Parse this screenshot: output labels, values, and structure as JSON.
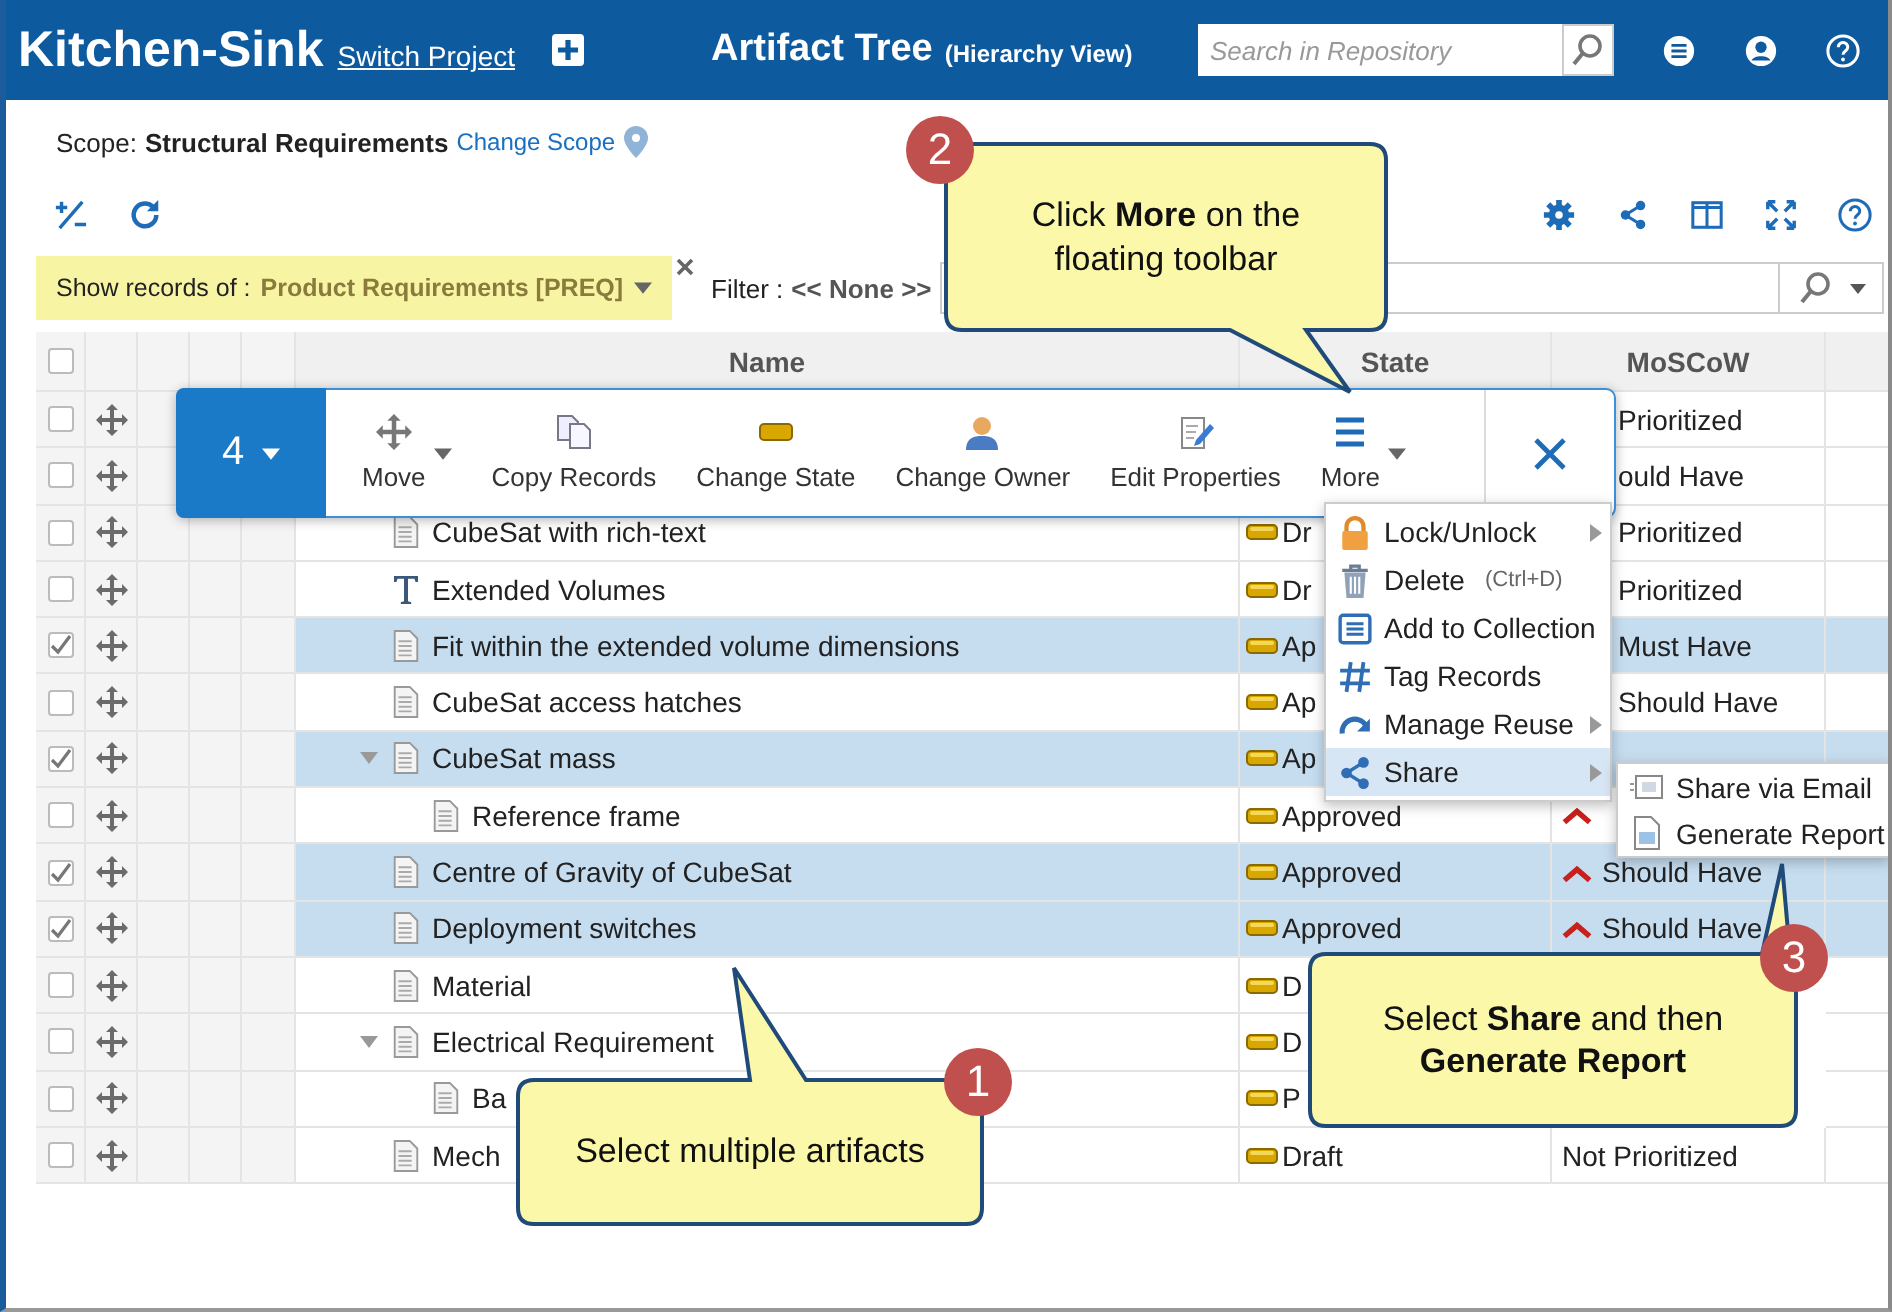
{
  "header": {
    "project": "Kitchen-Sink",
    "switch_link": "Switch Project",
    "title": "Artifact Tree",
    "subtitle": "(Hierarchy View)",
    "search": {
      "placeholder": "Search in Repository"
    }
  },
  "scope": {
    "label": "Scope:",
    "value": "Structural Requirements",
    "change_link": "Change Scope"
  },
  "filter_bar": {
    "show_label": "Show records of :",
    "show_value": "Product Requirements [PREQ]",
    "filter_label": "Filter :",
    "filter_value": "<< None >>"
  },
  "table": {
    "select_all_checked": false,
    "columns": [
      "Name",
      "State",
      "MoSCoW"
    ],
    "rows": [
      {
        "checked": false,
        "moscow": "Prioritized",
        "moscow_icon": false
      },
      {
        "checked": false,
        "moscow": "ould Have",
        "moscow_icon": false
      },
      {
        "checked": false,
        "kind": "document",
        "name": "CubeSat with rich-text",
        "state": "Dr",
        "moscow": "Prioritized",
        "moscow_icon": false
      },
      {
        "checked": false,
        "kind": "text",
        "name": "Extended Volumes",
        "state": "Dr",
        "moscow": "Prioritized",
        "moscow_icon": false
      },
      {
        "checked": true,
        "kind": "document",
        "name": "Fit within the extended volume dimensions",
        "state": "Ap",
        "moscow": "Must Have",
        "moscow_icon": false
      },
      {
        "checked": false,
        "kind": "document",
        "name": "CubeSat access hatches",
        "state": "Ap",
        "moscow": "Should Have",
        "moscow_icon": false
      },
      {
        "checked": true,
        "kind": "document",
        "name": "CubeSat mass",
        "state": "Ap",
        "moscow_icon": false,
        "expanded": true,
        "children": [
          {
            "checked": false,
            "kind": "document",
            "name": "Reference frame",
            "state": "Approved",
            "moscow_icon": true
          }
        ]
      },
      {
        "checked": true,
        "kind": "document",
        "name": "Centre of Gravity of CubeSat",
        "state": "Approved",
        "moscow": "Should Have",
        "moscow_icon": true
      },
      {
        "checked": true,
        "kind": "document",
        "name": "Deployment switches",
        "state": "Approved",
        "moscow": "Should Have",
        "moscow_icon": true
      },
      {
        "checked": false,
        "kind": "document",
        "name": "Material",
        "state": "D",
        "moscow_icon": false
      },
      {
        "checked": false,
        "kind": "document",
        "name": "Electrical Requirement",
        "state": "D",
        "moscow_icon": false,
        "expanded": true,
        "children": [
          {
            "checked": false,
            "kind": "document",
            "name": "Ba",
            "state": "P",
            "moscow_icon": false
          }
        ]
      },
      {
        "checked": false,
        "kind": "document",
        "name": "Mech",
        "state": "Draft",
        "moscow": "Not Prioritized",
        "moscow_icon": false
      }
    ]
  },
  "floating_toolbar": {
    "count": "4",
    "buttons": [
      {
        "label": "Move",
        "dropdown": true
      },
      {
        "label": "Copy Records",
        "dropdown": false
      },
      {
        "label": "Change State",
        "dropdown": false
      },
      {
        "label": "Change Owner",
        "dropdown": false
      },
      {
        "label": "Edit Properties",
        "dropdown": false
      },
      {
        "label": "More",
        "dropdown": true
      }
    ]
  },
  "more_menu": {
    "items": [
      {
        "label": "Lock/Unlock",
        "submenu": true,
        "selected": false
      },
      {
        "label": "Delete",
        "shortcut": "(Ctrl+D)",
        "submenu": false,
        "selected": false
      },
      {
        "label": "Add to Collection",
        "submenu": false,
        "selected": false
      },
      {
        "label": "Tag Records",
        "submenu": false,
        "selected": false
      },
      {
        "label": "Manage Reuse",
        "submenu": true,
        "selected": false
      },
      {
        "label": "Share",
        "submenu": true,
        "selected": true
      }
    ]
  },
  "share_submenu": {
    "items": [
      {
        "label": "Share via Email"
      },
      {
        "label": "Generate Report"
      }
    ]
  },
  "callouts": [
    {
      "number": "2",
      "text": "Click **More** on the floating toolbar"
    },
    {
      "number": "1",
      "text": "Select multiple artifacts"
    },
    {
      "number": "3",
      "text": "Select **Share** and then **Generate Report**"
    }
  ]
}
